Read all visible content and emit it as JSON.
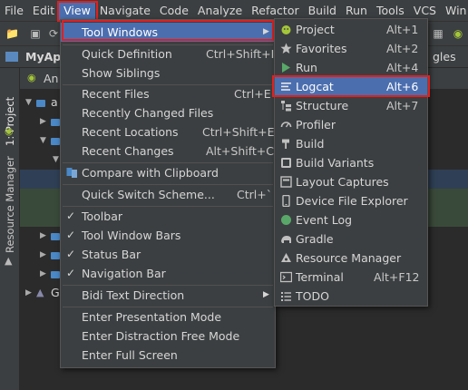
{
  "menubar": {
    "items": [
      "File",
      "Edit",
      "View",
      "Navigate",
      "Code",
      "Analyze",
      "Refactor",
      "Build",
      "Run",
      "Tools",
      "VCS",
      "Win"
    ],
    "active_index": 2
  },
  "navbar": {
    "project_crumb": "MyApp",
    "crumb_tail": "gles"
  },
  "tabs": {
    "partial_tab": "An"
  },
  "sidebar": {
    "project_tab": "1: Project",
    "resource_tab": "Resource Manager"
  },
  "tree": {
    "partial_root": "a",
    "partial_gradle": "G"
  },
  "view_menu": {
    "items": [
      {
        "label": "Tool Windows",
        "has_submenu": true,
        "active": true
      },
      {
        "label": "Quick Definition",
        "shortcut": "Ctrl+Shift+I"
      },
      {
        "label": "Show Siblings"
      },
      {
        "label": "Recent Files",
        "shortcut": "Ctrl+E"
      },
      {
        "label": "Recently Changed Files"
      },
      {
        "label": "Recent Locations",
        "shortcut": "Ctrl+Shift+E"
      },
      {
        "label": "Recent Changes",
        "shortcut": "Alt+Shift+C"
      },
      {
        "label": "Compare with Clipboard",
        "icon": "compare-icon"
      },
      {
        "label": "Quick Switch Scheme...",
        "shortcut": "Ctrl+`"
      },
      {
        "label": "Toolbar",
        "checked": true
      },
      {
        "label": "Tool Window Bars",
        "checked": true
      },
      {
        "label": "Status Bar",
        "checked": true
      },
      {
        "label": "Navigation Bar",
        "checked": true
      },
      {
        "label": "Bidi Text Direction",
        "has_submenu": true
      },
      {
        "label": "Enter Presentation Mode"
      },
      {
        "label": "Enter Distraction Free Mode"
      },
      {
        "label": "Enter Full Screen"
      }
    ]
  },
  "tool_windows_menu": {
    "items": [
      {
        "label": "Project",
        "shortcut": "Alt+1",
        "icon": "android-icon"
      },
      {
        "label": "Favorites",
        "shortcut": "Alt+2",
        "icon": "star-icon"
      },
      {
        "label": "Run",
        "shortcut": "Alt+4",
        "icon": "run-icon"
      },
      {
        "label": "Logcat",
        "shortcut": "Alt+6",
        "icon": "logcat-icon",
        "active": true
      },
      {
        "label": "Structure",
        "shortcut": "Alt+7",
        "icon": "structure-icon"
      },
      {
        "label": "Profiler",
        "icon": "profiler-icon"
      },
      {
        "label": "Build",
        "icon": "build-hammer-icon"
      },
      {
        "label": "Build Variants",
        "icon": "build-variants-icon"
      },
      {
        "label": "Layout Captures",
        "icon": "layout-captures-icon"
      },
      {
        "label": "Device File Explorer",
        "icon": "device-icon"
      },
      {
        "label": "Event Log",
        "icon": "event-log-icon"
      },
      {
        "label": "Gradle",
        "icon": "gradle-icon"
      },
      {
        "label": "Resource Manager",
        "icon": "resource-manager-icon"
      },
      {
        "label": "Terminal",
        "shortcut": "Alt+F12",
        "icon": "terminal-icon"
      },
      {
        "label": "TODO",
        "icon": "todo-icon"
      }
    ]
  },
  "colors": {
    "accent": "#4b6eaf",
    "highlight_box": "#e02020",
    "menu_bg": "#3c3f41",
    "android_green": "#a4c639"
  }
}
